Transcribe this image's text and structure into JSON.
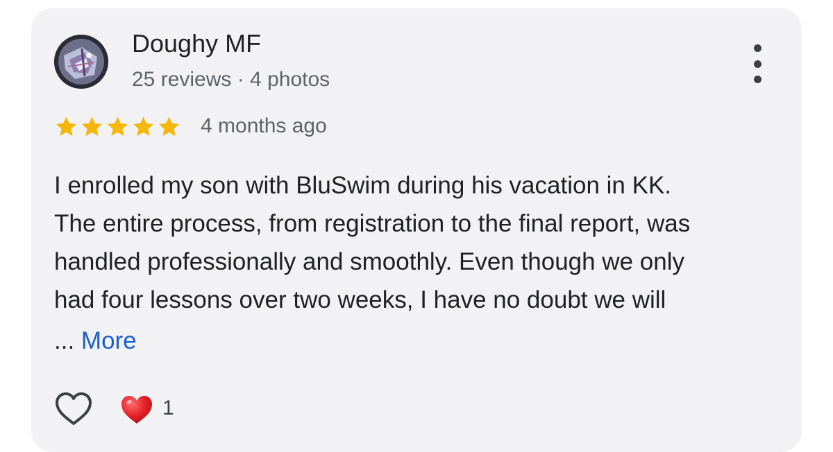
{
  "reviewer": {
    "name": "Doughy MF",
    "meta": "25 reviews · 4 photos"
  },
  "rating": {
    "stars": 5,
    "max": 5,
    "time": "4 months ago"
  },
  "review": {
    "lines": [
      "I enrolled my son with BluSwim during his vacation in KK.",
      "The entire process, from registration to the final report, was",
      "handled professionally and smoothly. Even though we only",
      "had four lessons over two weeks, I have no doubt we will"
    ],
    "ellipsis": "...",
    "more_label": "More"
  },
  "reactions": {
    "like_icon": "heart-outline-icon",
    "reaction_icon": "red-heart-icon",
    "count": "1"
  },
  "colors": {
    "card_bg": "#f2f2f4",
    "star": "#f6b70b",
    "link": "#1a5fc9",
    "heart": "#e21f26"
  }
}
